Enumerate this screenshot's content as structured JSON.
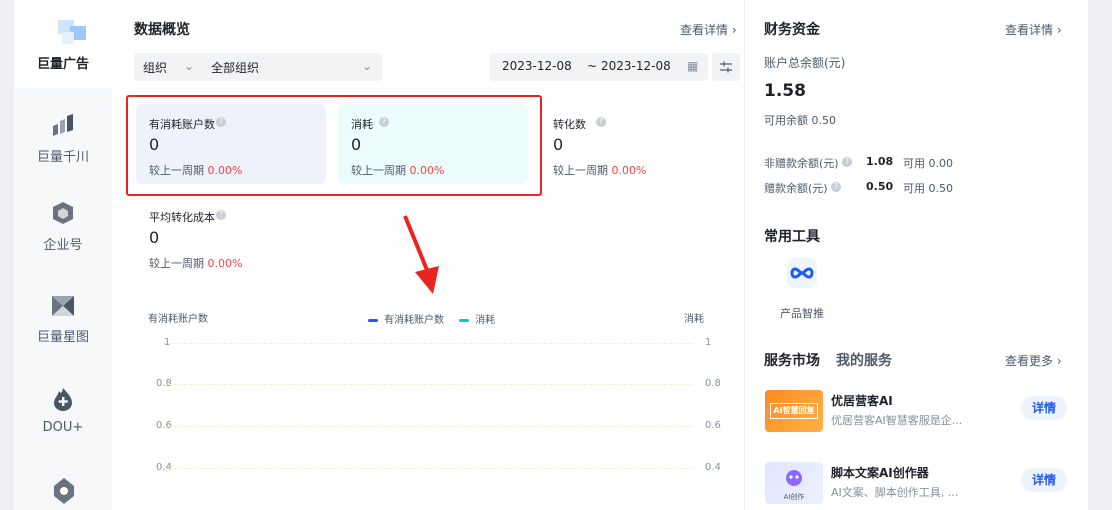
{
  "sidebar": {
    "brand_label": "巨量广告",
    "items": [
      {
        "label": "巨量千川",
        "icon": "bar-chart-icon"
      },
      {
        "label": "企业号",
        "icon": "hexagon-icon"
      },
      {
        "label": "巨量星图",
        "icon": "star-map-icon"
      },
      {
        "label": "DOU+",
        "icon": "flame-plus-icon"
      }
    ]
  },
  "overview": {
    "title": "数据概览",
    "details_link": "查看详情",
    "org_label": "组织",
    "org_value": "全部组织",
    "date_start": "2023-12-08",
    "date_sep": "~",
    "date_end": "2023-12-08",
    "metrics": [
      {
        "label": "有消耗账户数",
        "value": "0",
        "compare": "较上一周期",
        "pct": "0.00%"
      },
      {
        "label": "消耗",
        "value": "0",
        "compare": "较上一周期",
        "pct": "0.00%"
      },
      {
        "label": "转化数",
        "value": "0",
        "compare": "较上一周期",
        "pct": "0.00%"
      },
      {
        "label": "平均转化成本",
        "value": "0",
        "compare": "较上一周期",
        "pct": "0.00%"
      }
    ]
  },
  "chart_data": {
    "type": "line",
    "ylabel_left": "有消耗账户数",
    "ylabel_right": "消耗",
    "legend": [
      {
        "name": "有消耗账户数",
        "color": "#2f54eb"
      },
      {
        "name": "消耗",
        "color": "#13c2c2"
      }
    ],
    "yticks": [
      "1",
      "0.8",
      "0.6",
      "0.4"
    ],
    "series": []
  },
  "finance": {
    "title": "财务资金",
    "details_link": "查看详情",
    "total_label": "账户总余额(元)",
    "total_value": "1.58",
    "available": "可用余额 0.50",
    "nongift_label": "非赠款余额(元)",
    "nongift_value": "1.08",
    "nongift_available": "可用 0.00",
    "gift_label": "赠款余额(元)",
    "gift_value": "0.50",
    "gift_available": "可用 0.50"
  },
  "tools": {
    "title": "常用工具",
    "items": [
      {
        "label": "产品智推",
        "icon": "infinity-icon"
      }
    ]
  },
  "market": {
    "tab_market": "服务市场",
    "tab_mine": "我的服务",
    "more_link": "查看更多",
    "services": [
      {
        "name": "优居营客AI",
        "desc": "优居营客AI智慧客服是企...",
        "button": "详情",
        "thumb_text": "AI智慧回复"
      },
      {
        "name": "脚本文案AI创作器",
        "desc": "AI文案、脚本创作工具, ...",
        "button": "详情",
        "thumb_text": "AI创作"
      }
    ]
  },
  "accent_color": "#1d5cf0",
  "highlight_color": "#e8251f"
}
